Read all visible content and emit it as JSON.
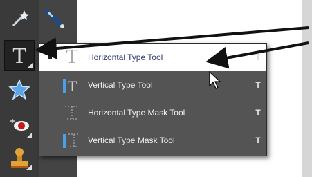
{
  "toolbar": {
    "tools": [
      {
        "icon": "magic-wand-icon"
      },
      {
        "icon": "quick-selection-icon"
      },
      {
        "icon": "type-tool-icon",
        "glyph": "T"
      },
      {
        "icon": "custom-shape-icon"
      },
      {
        "icon": "red-eye-icon"
      },
      {
        "icon": "clone-stamp-icon"
      }
    ]
  },
  "flyout": {
    "items": [
      {
        "label": "Horizontal Type Tool",
        "shortcut": "T",
        "icon": "horizontal-type-icon",
        "selected": true
      },
      {
        "label": "Vertical Type Tool",
        "shortcut": "T",
        "icon": "vertical-type-icon"
      },
      {
        "label": "Horizontal Type Mask Tool",
        "shortcut": "T",
        "icon": "horizontal-type-mask-icon"
      },
      {
        "label": "Vertical Type Mask Tool",
        "shortcut": "T",
        "icon": "vertical-type-mask-icon"
      }
    ]
  },
  "colors": {
    "toolbar_bg": "#3a3a3a",
    "menu_bg": "#545454",
    "selected_bg": "#ffffff",
    "arrow": "#111111"
  }
}
